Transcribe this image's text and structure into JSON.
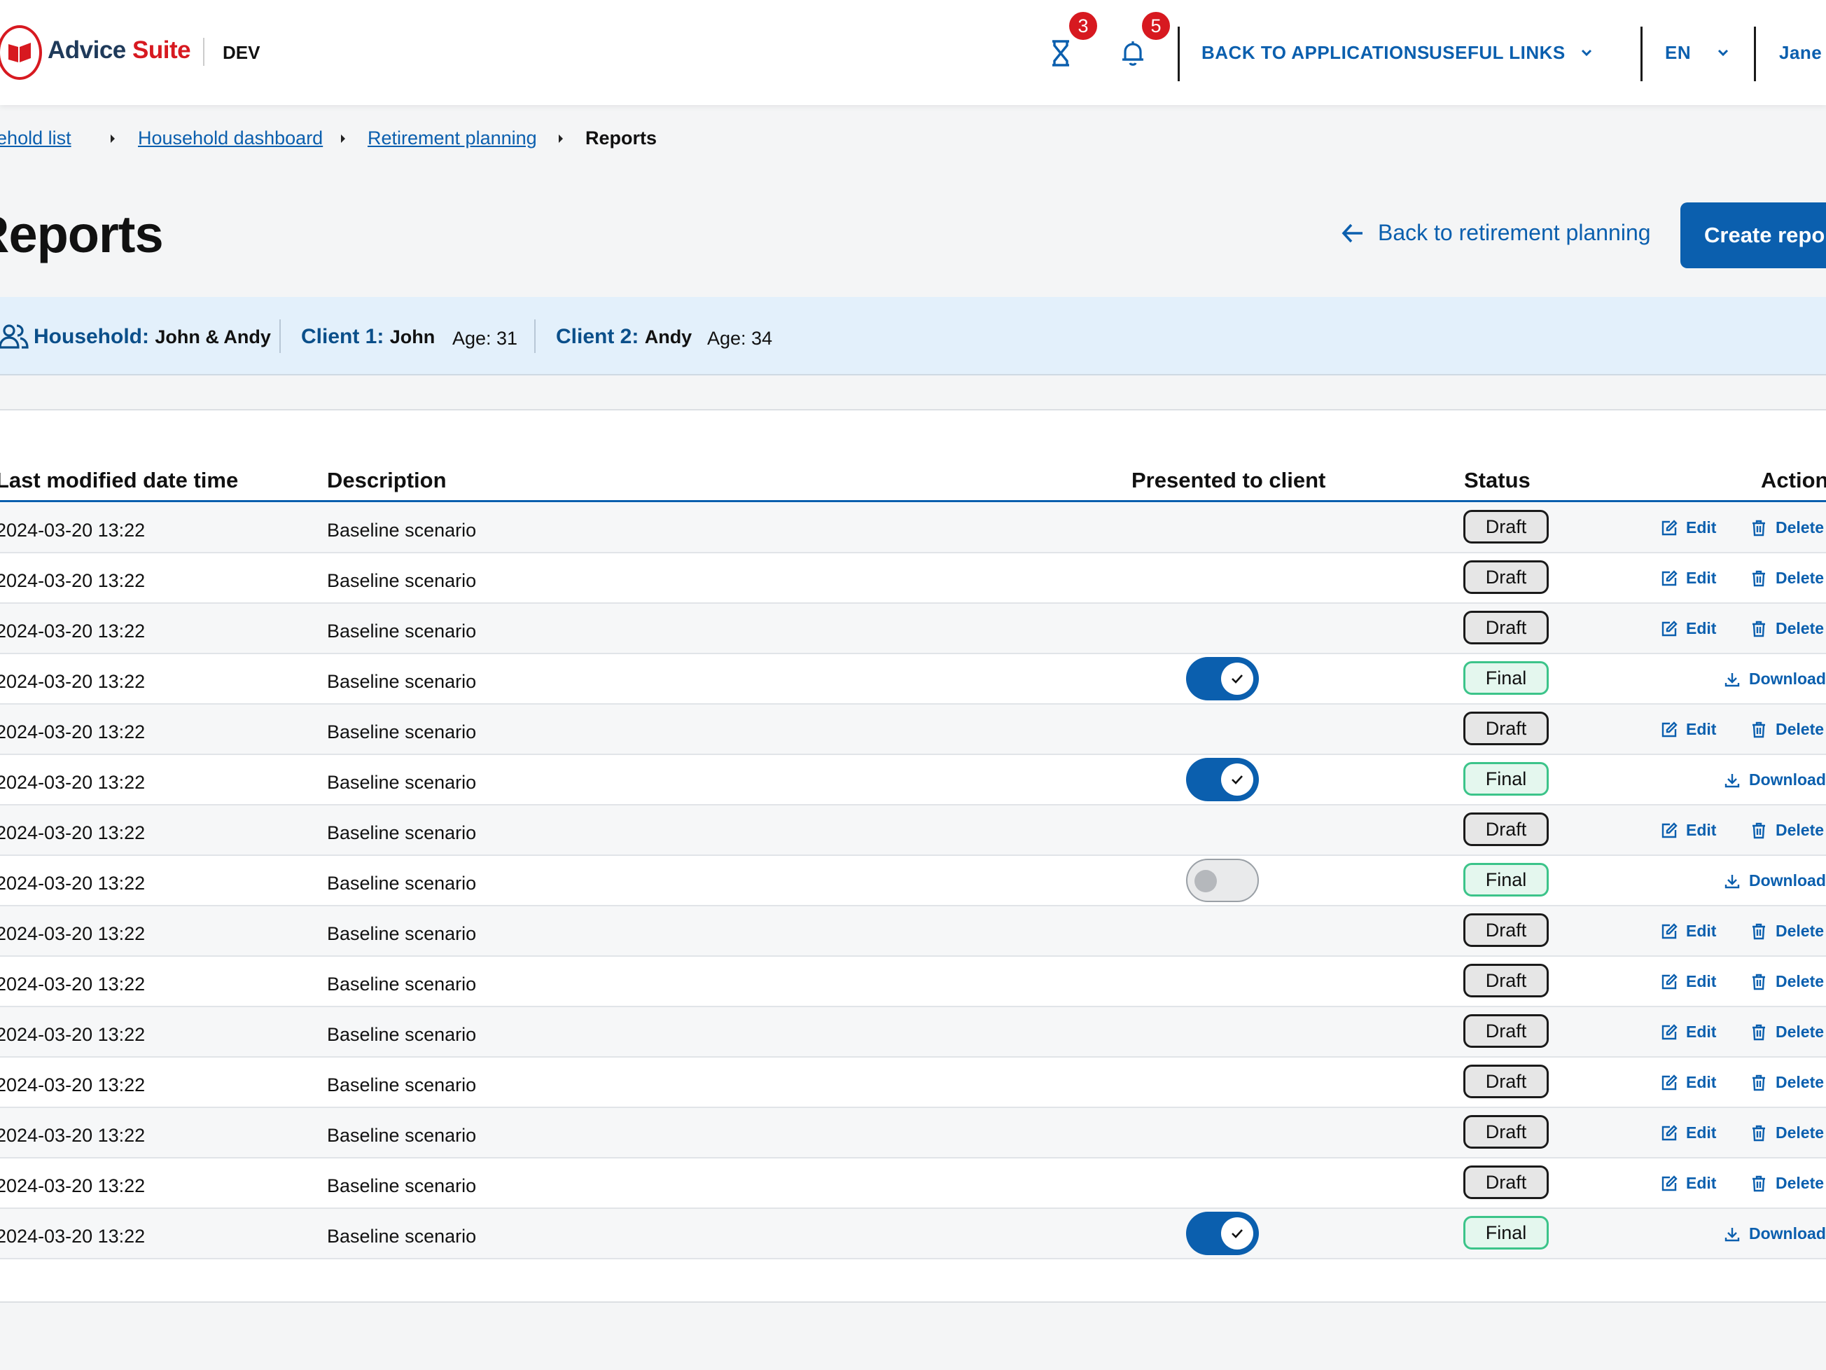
{
  "header": {
    "brand_part1": "Advice",
    "brand_part2": "Suite",
    "env": "DEV",
    "pending_count": "3",
    "notification_count": "5",
    "back_to_apps": "BACK TO APPLICATIONS",
    "useful_links": "USEFUL LINKS",
    "language": "EN",
    "user": "Jane D",
    "icons": [
      "hourglass-icon",
      "bell-icon",
      "chevron-down-icon"
    ]
  },
  "breadcrumb": {
    "items": [
      "Household list",
      "Household dashboard",
      "Retirement planning"
    ],
    "current": "Reports"
  },
  "page": {
    "title": "Reports",
    "back_link": "Back to retirement planning",
    "create_button": "Create report"
  },
  "household": {
    "household_label": "Household:",
    "household_value": "John & Andy",
    "client1_label": "Client 1:",
    "client1_name": "John",
    "client1_age": "Age: 31",
    "client2_label": "Client 2:",
    "client2_name": "Andy",
    "client2_age": "Age: 34"
  },
  "table": {
    "columns": [
      "Last modified date time",
      "Description",
      "Presented to client",
      "Status",
      "Actions"
    ],
    "action_labels": {
      "edit": "Edit",
      "delete": "Delete",
      "download": "Download"
    },
    "rows": [
      {
        "date": "2024-03-20 13:22",
        "description": "Baseline scenario",
        "status": "Draft",
        "presented": null
      },
      {
        "date": "2024-03-20 13:22",
        "description": "Baseline scenario",
        "status": "Draft",
        "presented": null
      },
      {
        "date": "2024-03-20 13:22",
        "description": "Baseline scenario",
        "status": "Draft",
        "presented": null
      },
      {
        "date": "2024-03-20 13:22",
        "description": "Baseline scenario",
        "status": "Final",
        "presented": true
      },
      {
        "date": "2024-03-20 13:22",
        "description": "Baseline scenario",
        "status": "Draft",
        "presented": null
      },
      {
        "date": "2024-03-20 13:22",
        "description": "Baseline scenario",
        "status": "Final",
        "presented": true
      },
      {
        "date": "2024-03-20 13:22",
        "description": "Baseline scenario",
        "status": "Draft",
        "presented": null
      },
      {
        "date": "2024-03-20 13:22",
        "description": "Baseline scenario",
        "status": "Final",
        "presented": false
      },
      {
        "date": "2024-03-20 13:22",
        "description": "Baseline scenario",
        "status": "Draft",
        "presented": null
      },
      {
        "date": "2024-03-20 13:22",
        "description": "Baseline scenario",
        "status": "Draft",
        "presented": null
      },
      {
        "date": "2024-03-20 13:22",
        "description": "Baseline scenario",
        "status": "Draft",
        "presented": null
      },
      {
        "date": "2024-03-20 13:22",
        "description": "Baseline scenario",
        "status": "Draft",
        "presented": null
      },
      {
        "date": "2024-03-20 13:22",
        "description": "Baseline scenario",
        "status": "Draft",
        "presented": null
      },
      {
        "date": "2024-03-20 13:22",
        "description": "Baseline scenario",
        "status": "Draft",
        "presented": null
      },
      {
        "date": "2024-03-20 13:22",
        "description": "Baseline scenario",
        "status": "Final",
        "presented": true
      }
    ]
  },
  "colors": {
    "primary": "#0b5fae",
    "brand_red": "#d71920",
    "final_border": "#3cc48a",
    "household_bg": "#e3f0fb"
  }
}
